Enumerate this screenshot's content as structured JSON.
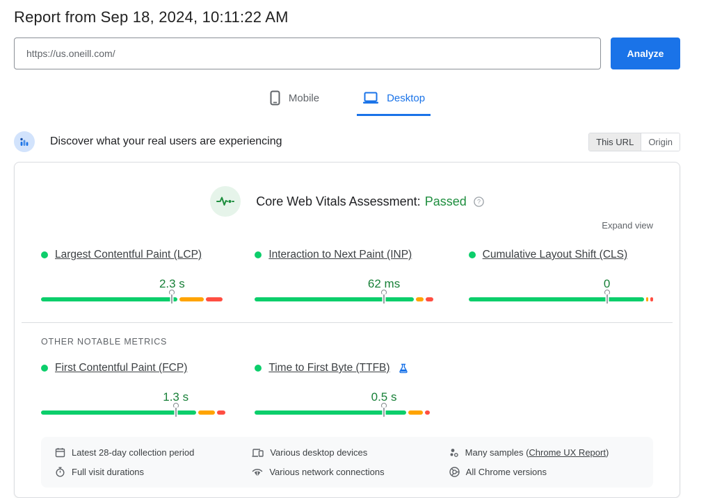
{
  "page": {
    "title": "Report from Sep 18, 2024, 10:11:22 AM"
  },
  "search": {
    "url": "https://us.oneill.com/",
    "analyze_label": "Analyze"
  },
  "tabs": {
    "mobile": {
      "label": "Mobile"
    },
    "desktop": {
      "label": "Desktop"
    }
  },
  "field_data": {
    "heading": "Discover what your real users are experiencing",
    "scope": {
      "this_url": "This URL",
      "origin": "Origin"
    }
  },
  "assessment": {
    "prefix": "Core Web Vitals Assessment:",
    "result": "Passed",
    "expand_label": "Expand view"
  },
  "metrics": {
    "core": [
      {
        "name": "Largest Contentful Paint (LCP)",
        "value": "2.3 s",
        "status": "good",
        "marker_pct": 71,
        "segments": [
          {
            "rating": "good",
            "pct": 74
          },
          {
            "rating": "needs_improvement",
            "pct": 13
          },
          {
            "rating": "poor",
            "pct": 9
          }
        ],
        "experimental": false
      },
      {
        "name": "Interaction to Next Paint (INP)",
        "value": "62 ms",
        "status": "good",
        "marker_pct": 70,
        "segments": [
          {
            "rating": "good",
            "pct": 86
          },
          {
            "rating": "needs_improvement",
            "pct": 4.5
          },
          {
            "rating": "poor",
            "pct": 4
          }
        ],
        "experimental": false
      },
      {
        "name": "Cumulative Layout Shift (CLS)",
        "value": "0",
        "status": "good",
        "marker_pct": 75,
        "segments": [
          {
            "rating": "good",
            "pct": 96.5
          },
          {
            "rating": "needs_improvement",
            "pct": 1
          },
          {
            "rating": "poor",
            "pct": 1.5
          }
        ],
        "experimental": false
      }
    ],
    "other_heading": "OTHER NOTABLE METRICS",
    "other": [
      {
        "name": "First Contentful Paint (FCP)",
        "value": "1.3 s",
        "status": "good",
        "marker_pct": 73,
        "segments": [
          {
            "rating": "good",
            "pct": 84
          },
          {
            "rating": "needs_improvement",
            "pct": 9
          },
          {
            "rating": "poor",
            "pct": 4.5
          }
        ],
        "experimental": false
      },
      {
        "name": "Time to First Byte (TTFB)",
        "value": "0.5 s",
        "status": "good",
        "marker_pct": 70,
        "segments": [
          {
            "rating": "good",
            "pct": 82
          },
          {
            "rating": "needs_improvement",
            "pct": 8
          },
          {
            "rating": "poor",
            "pct": 2.5
          }
        ],
        "experimental": true
      }
    ]
  },
  "footer": {
    "items": [
      {
        "icon": "calendar-icon",
        "text": "Latest 28-day collection period"
      },
      {
        "icon": "stopwatch-icon",
        "text": "Full visit durations"
      },
      {
        "icon": "devices-icon",
        "text": "Various desktop devices"
      },
      {
        "icon": "network-icon",
        "text": "Various network connections"
      },
      {
        "icon": "samples-icon",
        "prefix": "Many samples (",
        "link": "Chrome UX Report",
        "suffix": ")"
      },
      {
        "icon": "chrome-icon",
        "text": "All Chrome versions"
      }
    ]
  },
  "colors": {
    "accent_blue": "#1a73e8",
    "good": "#0cce6b",
    "needs_improvement": "#ffa400",
    "poor": "#ff4e42",
    "value_green": "#188038",
    "passed_green": "#1e8e3e"
  }
}
